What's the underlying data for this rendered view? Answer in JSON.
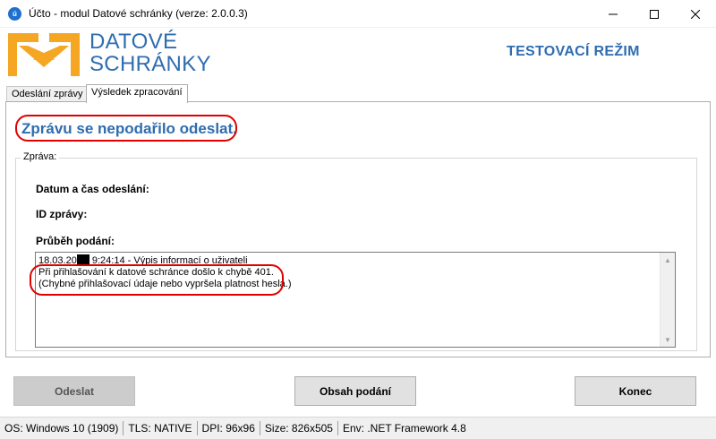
{
  "window": {
    "title": "Účto - modul Datové schránky (verze: 2.0.0.3)",
    "app_icon": "app-logo-icon"
  },
  "header": {
    "brand_line1": "DATOVÉ",
    "brand_line2": "SCHRÁNKY",
    "mode": "TESTOVACÍ REŽIM"
  },
  "tabs": [
    {
      "label": "Odeslání zprávy"
    },
    {
      "label": "Výsledek zpracování",
      "active": true
    }
  ],
  "result": {
    "status": "Zprávu se nepodařilo odeslat.",
    "group_label": "Zpráva:",
    "date_label": "Datum a čas odeslání:",
    "id_label": "ID zprávy:",
    "progress_label": "Průběh podání:",
    "log": {
      "line1_prefix": "18.03.20",
      "line1_suffix": " 9:24:14 - Výpis informací o uživateli",
      "line2": "Při přihlašování k datové schránce došlo k chybě 401.",
      "line3": "(Chybné přihlašovací údaje nebo vypršela platnost hesla.)"
    }
  },
  "buttons": {
    "send": "Odeslat",
    "content": "Obsah podání",
    "end": "Konec"
  },
  "statusbar": {
    "os": "OS:  Windows 10 (1909)",
    "tls": "TLS:  NATIVE",
    "dpi": "DPI:  96x96",
    "size": "Size:  826x505",
    "env": "Env:  .NET Framework 4.8"
  },
  "colors": {
    "brand_blue": "#2e6db0",
    "logo_orange": "#f5a623",
    "annotation_red": "#e00000"
  }
}
